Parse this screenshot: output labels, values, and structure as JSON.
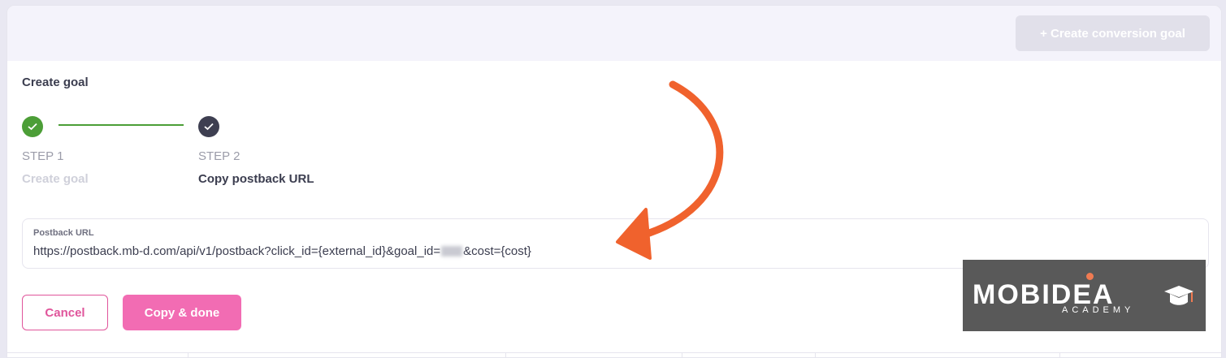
{
  "header": {
    "create_button_label": "+ Create conversion goal"
  },
  "section_title": "Create goal",
  "steps": [
    {
      "number": "STEP 1",
      "label": "Create goal",
      "status": "complete"
    },
    {
      "number": "STEP 2",
      "label": "Copy postback URL",
      "status": "current"
    }
  ],
  "postback": {
    "label": "Postback URL",
    "value_before": "https://postback.mb-d.com/api/v1/postback?click_id={external_id}&goal_id=",
    "value_after": "&cost={cost}"
  },
  "actions": {
    "cancel_label": "Cancel",
    "copy_label": "Copy & done"
  },
  "watermark": {
    "title": "MOBIDEA",
    "subtitle": "ACADEMY"
  },
  "colors": {
    "accent_pink": "#f26cb3",
    "success_green": "#4c9e37",
    "arrow_orange": "#f0622d"
  },
  "icons": {
    "step_complete": "check-icon",
    "annotation": "curved-arrow-icon"
  }
}
